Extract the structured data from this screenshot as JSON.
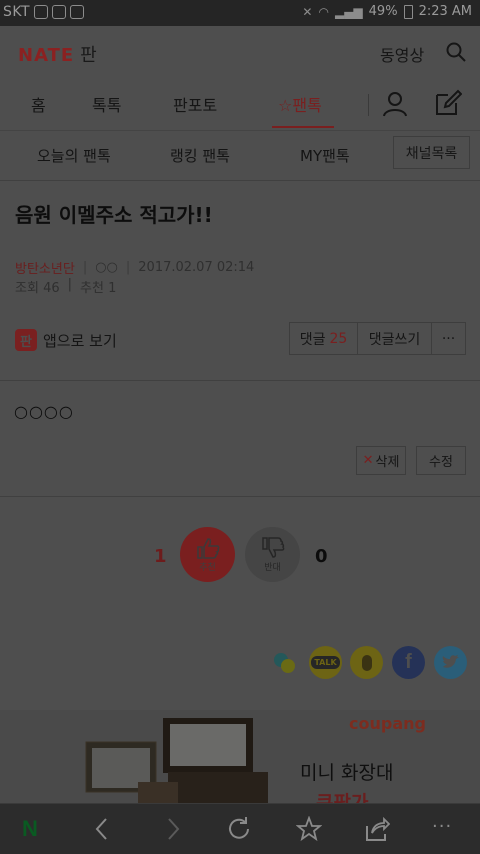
{
  "status_bar": {
    "carrier": "SKT",
    "battery": "49%",
    "time": "2:23 AM"
  },
  "header": {
    "logo": "NATE",
    "logo_sub": "판",
    "video_link": "동영상"
  },
  "nav": {
    "tabs": [
      "홈",
      "톡톡",
      "판포토",
      "팬톡"
    ],
    "active_tab": "팬톡"
  },
  "subnav": {
    "items": [
      "오늘의 팬톡",
      "랭킹 팬톡",
      "MY팬톡"
    ],
    "channel_button": "채널목록"
  },
  "post": {
    "title": "음원 이멜주소 적고가!!",
    "author": "방탄소년단",
    "user": "○○",
    "date": "2017.02.07 02:14",
    "views_label": "조회",
    "views": "46",
    "recommend_label": "추천",
    "recommend": "1",
    "body": "○○○○"
  },
  "actions": {
    "app_view": "앱으로 보기",
    "app_icon_glyph": "판",
    "comment_label": "댓글",
    "comment_count": "25",
    "write_comment": "댓글쓰기",
    "more": "···",
    "delete": "삭제",
    "edit": "수정"
  },
  "vote": {
    "up_count": "1",
    "up_label": "추천",
    "down_label": "반대",
    "down_count": "0"
  },
  "share": {
    "kakao_talk": "TALK"
  },
  "ad": {
    "brand": "coupang",
    "line1": "미니 화장대",
    "line2": "쿠팡가"
  },
  "bottom_bar": {
    "home_glyph": "N",
    "more_glyph": "···"
  },
  "colors": {
    "brand_red": "#e0342c",
    "dim_overlay": "#4e4e4e"
  }
}
